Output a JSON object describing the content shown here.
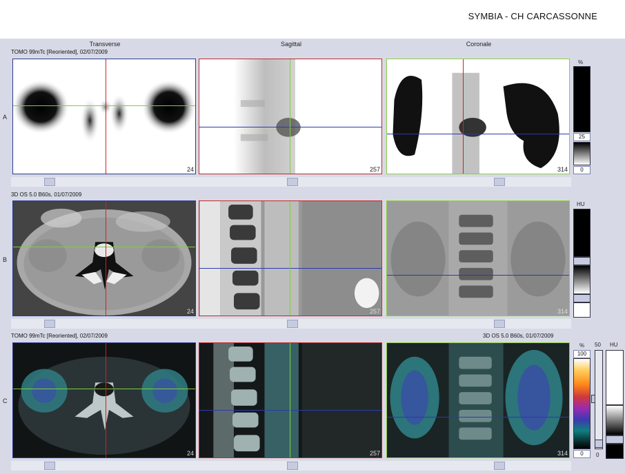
{
  "header": {
    "site": "SYMBIA - CH CARCASSONNE"
  },
  "columns": {
    "transverse": "Transverse",
    "sagittal": "Sagittal",
    "coronal": "Coronale"
  },
  "rows": {
    "a": {
      "label": "A",
      "series": "TOMO 99mTc [Reoriented], 02/07/2009"
    },
    "b": {
      "label": "B",
      "series": "3D  OS  5.0  B60s, 01/07/2009"
    },
    "c": {
      "label": "C",
      "series_left": "TOMO 99mTc [Reoriented], 02/07/2009",
      "series_right": "3D  OS  5.0  B60s, 01/07/2009"
    }
  },
  "slices": {
    "transverse": "24",
    "sagittal": "257",
    "coronal": "314"
  },
  "scales": {
    "a": {
      "unit": "%",
      "max": "25",
      "min": "0"
    },
    "b": {
      "unit": "HU"
    },
    "c": {
      "unit_pct": "%",
      "unit_hu": "HU",
      "pct_max": "100",
      "pct_min": "0",
      "hu_max": "50",
      "hu_min": "0"
    }
  },
  "colors": {
    "transverse": "#2b3a8f",
    "sagittal": "#c0282a",
    "coronal": "#8ccf3c",
    "cursor_v": "#d22020",
    "cursor_h_green": "#7ed03a",
    "cursor_h_blue": "#2a3ab0"
  },
  "icons": {
    "slider": "slider-thumb-icon"
  }
}
